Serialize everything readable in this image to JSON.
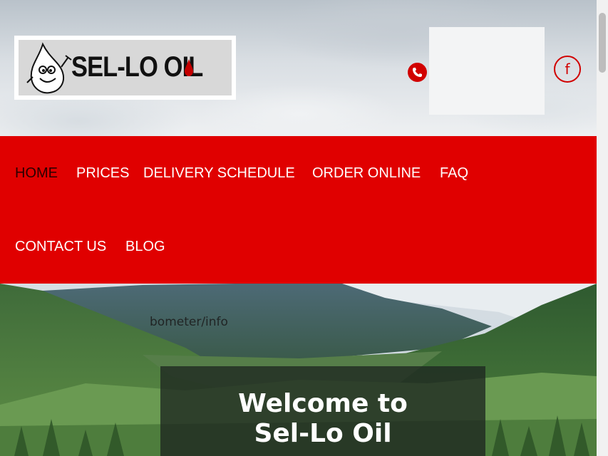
{
  "header": {
    "logo_text": "SEL-LO OIL",
    "phone_icon": "phone-icon",
    "social_icon": "facebook-icon"
  },
  "nav": {
    "items": [
      {
        "label": "HOME",
        "active": true
      },
      {
        "label": "PRICES"
      },
      {
        "label": "DELIVERY SCHEDULE"
      },
      {
        "label": "ORDER ONLINE"
      },
      {
        "label": "FAQ"
      },
      {
        "label": "CONTACT US"
      },
      {
        "label": "BLOG"
      }
    ]
  },
  "hero": {
    "overlay_text": "bometer/info",
    "welcome_line1": "Welcome to",
    "welcome_line2": "Sel-Lo Oil"
  },
  "colors": {
    "brand_red": "#e00000",
    "icon_red": "#d10000"
  }
}
